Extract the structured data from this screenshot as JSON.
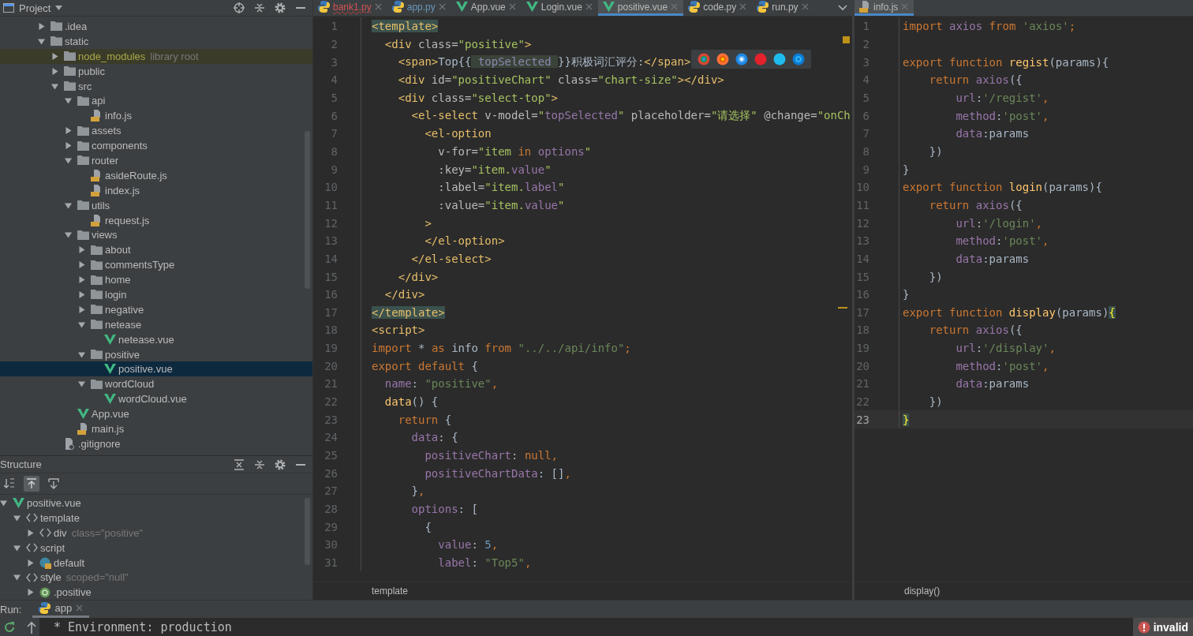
{
  "project": {
    "title": "Project",
    "tree": [
      {
        "label": ".idea",
        "kind": "folder",
        "expanded": false,
        "selected": false
      },
      {
        "label": "static",
        "kind": "folder",
        "expanded": true,
        "selected": false,
        "children": [
          {
            "label": "node_modules",
            "kind": "library",
            "hint": "library root",
            "expanded": false,
            "selected": false
          },
          {
            "label": "public",
            "kind": "folder",
            "expanded": false,
            "selected": false
          },
          {
            "label": "src",
            "kind": "folder",
            "expanded": true,
            "selected": false,
            "children": [
              {
                "label": "api",
                "kind": "folder",
                "expanded": true,
                "selected": false,
                "children": [
                  {
                    "label": "info.js",
                    "kind": "js",
                    "selected": false
                  }
                ]
              },
              {
                "label": "assets",
                "kind": "folder",
                "expanded": false,
                "selected": false
              },
              {
                "label": "components",
                "kind": "folder",
                "expanded": false,
                "selected": false
              },
              {
                "label": "router",
                "kind": "folder",
                "expanded": true,
                "selected": false,
                "children": [
                  {
                    "label": "asideRoute.js",
                    "kind": "js",
                    "selected": false
                  },
                  {
                    "label": "index.js",
                    "kind": "js",
                    "selected": false
                  }
                ]
              },
              {
                "label": "utils",
                "kind": "folder",
                "expanded": true,
                "selected": false,
                "children": [
                  {
                    "label": "request.js",
                    "kind": "js",
                    "selected": false
                  }
                ]
              },
              {
                "label": "views",
                "kind": "folder",
                "expanded": true,
                "selected": false,
                "children": [
                  {
                    "label": "about",
                    "kind": "folder",
                    "expanded": false,
                    "selected": false
                  },
                  {
                    "label": "commentsType",
                    "kind": "folder",
                    "expanded": false,
                    "selected": false
                  },
                  {
                    "label": "home",
                    "kind": "folder",
                    "expanded": false,
                    "selected": false
                  },
                  {
                    "label": "login",
                    "kind": "folder",
                    "expanded": false,
                    "selected": false
                  },
                  {
                    "label": "negative",
                    "kind": "folder",
                    "expanded": false,
                    "selected": false
                  },
                  {
                    "label": "netease",
                    "kind": "folder",
                    "expanded": true,
                    "selected": false,
                    "children": [
                      {
                        "label": "netease.vue",
                        "kind": "vue",
                        "selected": false
                      }
                    ]
                  },
                  {
                    "label": "positive",
                    "kind": "folder",
                    "expanded": true,
                    "selected": false,
                    "children": [
                      {
                        "label": "positive.vue",
                        "kind": "vue",
                        "selected": true
                      }
                    ]
                  },
                  {
                    "label": "wordCloud",
                    "kind": "folder",
                    "expanded": true,
                    "selected": false,
                    "children": [
                      {
                        "label": "wordCloud.vue",
                        "kind": "vue",
                        "selected": false
                      }
                    ]
                  }
                ]
              },
              {
                "label": "App.vue",
                "kind": "vue",
                "selected": false
              },
              {
                "label": "main.js",
                "kind": "js",
                "selected": false
              }
            ]
          },
          {
            "label": ".gitignore",
            "kind": "file",
            "selected": false
          }
        ]
      }
    ]
  },
  "structure": {
    "title": "Structure",
    "tools": [
      {
        "kind": "sort",
        "on": false
      },
      {
        "kind": "scroll-from",
        "on": true
      },
      {
        "kind": "scroll-to",
        "on": false
      }
    ],
    "tree": [
      {
        "label": "positive.vue",
        "kind": "vue",
        "expanded": true,
        "selected": false,
        "children": [
          {
            "label": "template",
            "kind": "tag",
            "expanded": true,
            "selected": false,
            "children": [
              {
                "label": "div",
                "kind": "tag",
                "hint": "class=\"positive\"",
                "expanded": false,
                "selected": false
              }
            ]
          },
          {
            "label": "script",
            "kind": "tag",
            "expanded": true,
            "selected": false,
            "children": [
              {
                "label": "default",
                "kind": "object",
                "expanded": false,
                "selected": false
              }
            ]
          },
          {
            "label": "style",
            "kind": "tag",
            "hint": "scoped=\"null\"",
            "expanded": true,
            "selected": false,
            "children": [
              {
                "label": ".positive",
                "kind": "css",
                "expanded": false,
                "selected": false
              }
            ]
          }
        ]
      }
    ]
  },
  "editors": [
    {
      "tabs": [
        {
          "label": "bank1.py",
          "kind": "py",
          "has_errors": true,
          "modified": false,
          "selected": false
        },
        {
          "label": "app.py",
          "kind": "py",
          "has_errors": false,
          "modified": true,
          "selected": false
        },
        {
          "label": "App.vue",
          "kind": "vue",
          "has_errors": false,
          "modified": false,
          "selected": false
        },
        {
          "label": "Login.vue",
          "kind": "vue",
          "has_errors": false,
          "modified": false,
          "selected": false
        },
        {
          "label": "positive.vue",
          "kind": "vue",
          "has_errors": false,
          "modified": false,
          "selected": true
        },
        {
          "label": "code.py",
          "kind": "py",
          "has_errors": false,
          "modified": false,
          "selected": false
        },
        {
          "label": "run.py",
          "kind": "py",
          "has_errors": false,
          "modified": false,
          "selected": false
        }
      ],
      "lines": [
        {
          "number": "1",
          "tokens": [
            {
              "text": "<template>",
              "kind": "match"
            }
          ]
        },
        {
          "number": "2",
          "tokens": [
            {
              "text": "  <div ",
              "kind": "tag"
            },
            {
              "text": "class=",
              "kind": "attr"
            },
            {
              "text": "\"positive\"",
              "kind": "value"
            },
            {
              "text": ">",
              "kind": "tag"
            }
          ]
        },
        {
          "number": "3",
          "tokens": [
            {
              "text": "    <span>",
              "kind": "tag"
            },
            {
              "text": "Top{{",
              "kind": "plain"
            },
            {
              "text": " topSelected ",
              "kind": "inlay"
            },
            {
              "text": "}}积极词汇评分:",
              "kind": "plain"
            },
            {
              "text": "</span>",
              "kind": "tag"
            }
          ]
        },
        {
          "number": "4",
          "tokens": [
            {
              "text": "    <div ",
              "kind": "tag"
            },
            {
              "text": "id=",
              "kind": "attr"
            },
            {
              "text": "\"positiveChart\" ",
              "kind": "value"
            },
            {
              "text": "class=",
              "kind": "attr"
            },
            {
              "text": "\"chart-size\"",
              "kind": "value"
            },
            {
              "text": "></div>",
              "kind": "tag"
            }
          ]
        },
        {
          "number": "5",
          "tokens": [
            {
              "text": "    <div ",
              "kind": "tag"
            },
            {
              "text": "class=",
              "kind": "attr"
            },
            {
              "text": "\"select-top\"",
              "kind": "value"
            },
            {
              "text": ">",
              "kind": "tag"
            }
          ]
        },
        {
          "number": "6",
          "tokens": [
            {
              "text": "      <el-select ",
              "kind": "tag"
            },
            {
              "text": "v-model=",
              "kind": "attr"
            },
            {
              "text": "\"",
              "kind": "value"
            },
            {
              "text": "topSelected",
              "kind": "field"
            },
            {
              "text": "\" ",
              "kind": "value"
            },
            {
              "text": "placeholder=",
              "kind": "attr"
            },
            {
              "text": "\"请选择\" ",
              "kind": "value"
            },
            {
              "text": "@change=",
              "kind": "attr"
            },
            {
              "text": "\"onCh",
              "kind": "value"
            }
          ]
        },
        {
          "number": "7",
          "tokens": [
            {
              "text": "        <el-option",
              "kind": "tag"
            }
          ]
        },
        {
          "number": "8",
          "tokens": [
            {
              "text": "          v-for=",
              "kind": "attr"
            },
            {
              "text": "\"item ",
              "kind": "value"
            },
            {
              "text": "in ",
              "kind": "keyword"
            },
            {
              "text": "options",
              "kind": "field"
            },
            {
              "text": "\"",
              "kind": "value"
            }
          ]
        },
        {
          "number": "9",
          "tokens": [
            {
              "text": "          :key=",
              "kind": "attr"
            },
            {
              "text": "\"item.",
              "kind": "value"
            },
            {
              "text": "value",
              "kind": "field"
            },
            {
              "text": "\"",
              "kind": "value"
            }
          ]
        },
        {
          "number": "10",
          "tokens": [
            {
              "text": "          :label=",
              "kind": "attr"
            },
            {
              "text": "\"item.",
              "kind": "value"
            },
            {
              "text": "label",
              "kind": "field"
            },
            {
              "text": "\"",
              "kind": "value"
            }
          ]
        },
        {
          "number": "11",
          "tokens": [
            {
              "text": "          :value=",
              "kind": "attr"
            },
            {
              "text": "\"item.",
              "kind": "value"
            },
            {
              "text": "value",
              "kind": "field"
            },
            {
              "text": "\"",
              "kind": "value"
            }
          ]
        },
        {
          "number": "12",
          "tokens": [
            {
              "text": "        >",
              "kind": "tag"
            }
          ]
        },
        {
          "number": "13",
          "tokens": [
            {
              "text": "        </el-option>",
              "kind": "tag"
            }
          ]
        },
        {
          "number": "14",
          "tokens": [
            {
              "text": "      </el-select>",
              "kind": "tag"
            }
          ]
        },
        {
          "number": "15",
          "tokens": [
            {
              "text": "    </div>",
              "kind": "tag"
            }
          ]
        },
        {
          "number": "16",
          "tokens": [
            {
              "text": "  </div>",
              "kind": "tag"
            }
          ]
        },
        {
          "number": "17",
          "tokens": [
            {
              "text": "</template>",
              "kind": "match"
            }
          ]
        },
        {
          "number": "18",
          "tokens": [
            {
              "text": "<script>",
              "kind": "tag"
            }
          ]
        },
        {
          "number": "19",
          "tokens": [
            {
              "text": "import ",
              "kind": "keyword"
            },
            {
              "text": "* ",
              "kind": "plain"
            },
            {
              "text": "as ",
              "kind": "keyword"
            },
            {
              "text": "info ",
              "kind": "plain"
            },
            {
              "text": "from ",
              "kind": "keyword"
            },
            {
              "text": "\"../../api/info\"",
              "kind": "string"
            },
            {
              "text": ";",
              "kind": "keyword"
            }
          ]
        },
        {
          "number": "20",
          "tokens": [
            {
              "text": "export default ",
              "kind": "keyword"
            },
            {
              "text": "{",
              "kind": "plain"
            }
          ]
        },
        {
          "number": "21",
          "tokens": [
            {
              "text": "  name",
              "kind": "field"
            },
            {
              "text": ": ",
              "kind": "plain"
            },
            {
              "text": "\"positive\"",
              "kind": "string"
            },
            {
              "text": ",",
              "kind": "keyword"
            }
          ]
        },
        {
          "number": "22",
          "tokens": [
            {
              "text": "  data",
              "kind": "func"
            },
            {
              "text": "() {",
              "kind": "plain"
            }
          ]
        },
        {
          "number": "23",
          "tokens": [
            {
              "text": "    return ",
              "kind": "keyword"
            },
            {
              "text": "{",
              "kind": "plain"
            }
          ]
        },
        {
          "number": "24",
          "tokens": [
            {
              "text": "      data",
              "kind": "field"
            },
            {
              "text": ": {",
              "kind": "plain"
            }
          ]
        },
        {
          "number": "25",
          "tokens": [
            {
              "text": "        positiveChart",
              "kind": "field"
            },
            {
              "text": ": ",
              "kind": "plain"
            },
            {
              "text": "null,",
              "kind": "keyword"
            }
          ]
        },
        {
          "number": "26",
          "tokens": [
            {
              "text": "        positiveChartData",
              "kind": "field"
            },
            {
              "text": ": []",
              "kind": "plain"
            },
            {
              "text": ",",
              "kind": "keyword"
            }
          ]
        },
        {
          "number": "27",
          "tokens": [
            {
              "text": "      }",
              "kind": "plain"
            },
            {
              "text": ",",
              "kind": "keyword"
            }
          ]
        },
        {
          "number": "28",
          "tokens": [
            {
              "text": "      options",
              "kind": "field"
            },
            {
              "text": ": [",
              "kind": "plain"
            }
          ]
        },
        {
          "number": "29",
          "tokens": [
            {
              "text": "        {",
              "kind": "plain"
            }
          ]
        },
        {
          "number": "30",
          "tokens": [
            {
              "text": "          value",
              "kind": "field"
            },
            {
              "text": ": ",
              "kind": "plain"
            },
            {
              "text": "5",
              "kind": "number"
            },
            {
              "text": ",",
              "kind": "keyword"
            }
          ]
        },
        {
          "number": "31",
          "tokens": [
            {
              "text": "          label",
              "kind": "field"
            },
            {
              "text": ": ",
              "kind": "plain"
            },
            {
              "text": "\"Top5\"",
              "kind": "string"
            },
            {
              "text": ",",
              "kind": "keyword"
            }
          ]
        }
      ],
      "breadcrumb": "template"
    },
    {
      "tabs": [
        {
          "label": "info.js",
          "kind": "js",
          "has_errors": false,
          "modified": false,
          "selected": true
        }
      ],
      "lines": [
        {
          "number": "1",
          "current": false,
          "tokens": [
            {
              "text": "import ",
              "kind": "keyword"
            },
            {
              "text": "axios",
              "kind": "field"
            },
            {
              "text": " from ",
              "kind": "keyword"
            },
            {
              "text": "'axios'",
              "kind": "string"
            },
            {
              "text": ";",
              "kind": "keyword"
            }
          ]
        },
        {
          "number": "2",
          "current": false
        },
        {
          "number": "3",
          "current": false,
          "tokens": [
            {
              "text": "export function ",
              "kind": "keyword"
            },
            {
              "text": "regist",
              "kind": "func"
            },
            {
              "text": "(params){",
              "kind": "plain"
            }
          ]
        },
        {
          "number": "4",
          "current": false,
          "tokens": [
            {
              "text": "    return ",
              "kind": "keyword"
            },
            {
              "text": "axios",
              "kind": "field"
            },
            {
              "text": "({",
              "kind": "plain"
            }
          ]
        },
        {
          "number": "5",
          "current": false,
          "tokens": [
            {
              "text": "        url",
              "kind": "field"
            },
            {
              "text": ":",
              "kind": "plain"
            },
            {
              "text": "'/regist'",
              "kind": "string"
            },
            {
              "text": ",",
              "kind": "keyword"
            }
          ]
        },
        {
          "number": "6",
          "current": false,
          "tokens": [
            {
              "text": "        method",
              "kind": "field"
            },
            {
              "text": ":",
              "kind": "plain"
            },
            {
              "text": "'post'",
              "kind": "string"
            },
            {
              "text": ",",
              "kind": "keyword"
            }
          ]
        },
        {
          "number": "7",
          "current": false,
          "tokens": [
            {
              "text": "        data",
              "kind": "field"
            },
            {
              "text": ":params",
              "kind": "plain"
            }
          ]
        },
        {
          "number": "8",
          "current": false,
          "tokens": [
            {
              "text": "    })",
              "kind": "plain"
            }
          ]
        },
        {
          "number": "9",
          "current": false,
          "tokens": [
            {
              "text": "}",
              "kind": "plain"
            }
          ]
        },
        {
          "number": "10",
          "current": false,
          "tokens": [
            {
              "text": "export function ",
              "kind": "keyword"
            },
            {
              "text": "login",
              "kind": "func"
            },
            {
              "text": "(params){",
              "kind": "plain"
            }
          ]
        },
        {
          "number": "11",
          "current": false,
          "tokens": [
            {
              "text": "    return ",
              "kind": "keyword"
            },
            {
              "text": "axios",
              "kind": "field"
            },
            {
              "text": "({",
              "kind": "plain"
            }
          ]
        },
        {
          "number": "12",
          "current": false,
          "tokens": [
            {
              "text": "        url",
              "kind": "field"
            },
            {
              "text": ":",
              "kind": "plain"
            },
            {
              "text": "'/login'",
              "kind": "string"
            },
            {
              "text": ",",
              "kind": "keyword"
            }
          ]
        },
        {
          "number": "13",
          "current": false,
          "tokens": [
            {
              "text": "        method",
              "kind": "field"
            },
            {
              "text": ":",
              "kind": "plain"
            },
            {
              "text": "'post'",
              "kind": "string"
            },
            {
              "text": ",",
              "kind": "keyword"
            }
          ]
        },
        {
          "number": "14",
          "current": false,
          "tokens": [
            {
              "text": "        data",
              "kind": "field"
            },
            {
              "text": ":params",
              "kind": "plain"
            }
          ]
        },
        {
          "number": "15",
          "current": false,
          "tokens": [
            {
              "text": "    })",
              "kind": "plain"
            }
          ]
        },
        {
          "number": "16",
          "current": false,
          "tokens": [
            {
              "text": "}",
              "kind": "plain"
            }
          ]
        },
        {
          "number": "17",
          "current": false,
          "tokens": [
            {
              "text": "export function ",
              "kind": "keyword"
            },
            {
              "text": "display",
              "kind": "func"
            },
            {
              "text": "(params)",
              "kind": "plain"
            },
            {
              "text": "{",
              "kind": "brace"
            }
          ]
        },
        {
          "number": "18",
          "current": false,
          "tokens": [
            {
              "text": "    return ",
              "kind": "keyword"
            },
            {
              "text": "axios",
              "kind": "field"
            },
            {
              "text": "({",
              "kind": "plain"
            }
          ]
        },
        {
          "number": "19",
          "current": false,
          "tokens": [
            {
              "text": "        url",
              "kind": "field"
            },
            {
              "text": ":",
              "kind": "plain"
            },
            {
              "text": "'/display'",
              "kind": "string"
            },
            {
              "text": ",",
              "kind": "keyword"
            }
          ]
        },
        {
          "number": "20",
          "current": false,
          "tokens": [
            {
              "text": "        method",
              "kind": "field"
            },
            {
              "text": ":",
              "kind": "plain"
            },
            {
              "text": "'post'",
              "kind": "string"
            },
            {
              "text": ",",
              "kind": "keyword"
            }
          ]
        },
        {
          "number": "21",
          "current": false,
          "tokens": [
            {
              "text": "        data",
              "kind": "field"
            },
            {
              "text": ":params",
              "kind": "plain"
            }
          ]
        },
        {
          "number": "22",
          "current": false,
          "tokens": [
            {
              "text": "    })",
              "kind": "plain"
            }
          ]
        },
        {
          "number": "23",
          "current": true,
          "tokens": [
            {
              "text": "}",
              "kind": "brace"
            }
          ]
        }
      ],
      "breadcrumb": "display()"
    }
  ],
  "run": {
    "label": "Run:",
    "tabs": [
      {
        "label": "app",
        "selected": true
      }
    ],
    "console": "* Environment: production",
    "status": "invalid"
  }
}
